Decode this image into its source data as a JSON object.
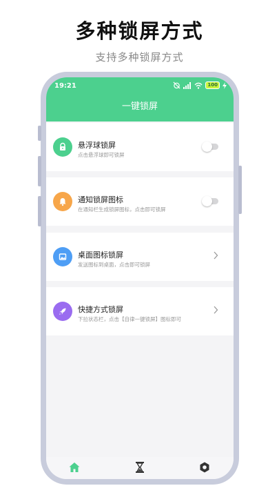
{
  "promo": {
    "title": "多种锁屏方式",
    "subtitle": "支持多种锁屏方式"
  },
  "status_bar": {
    "time": "19:21",
    "battery": "100",
    "icons": [
      "alarm-off-icon",
      "signal-icon",
      "wifi-icon",
      "battery-icon",
      "charging-icon"
    ]
  },
  "header": {
    "title": "一键锁屏"
  },
  "items": [
    {
      "title": "悬浮球锁屏",
      "desc": "点击悬浮球即可锁屏",
      "icon": "lock-icon",
      "icon_color": "#4cd08e",
      "control": "toggle",
      "enabled": false
    },
    {
      "title": "通知锁屏图标",
      "desc": "在通知栏生成锁屏图标，点击即可锁屏",
      "icon": "bell-icon",
      "icon_color": "#f7a64a",
      "control": "toggle",
      "enabled": false
    },
    {
      "title": "桌面图标锁屏",
      "desc": "发送图标到桌面，点击即可锁屏",
      "icon": "image-icon",
      "icon_color": "#4e9ef5",
      "control": "chevron"
    },
    {
      "title": "快捷方式锁屏",
      "desc": "下拉状态栏，点击【自律一键锁屏】图标即可",
      "icon": "rocket-icon",
      "icon_color": "#9a6cf0",
      "control": "chevron"
    }
  ],
  "tabs": [
    {
      "icon": "home-icon",
      "active": true
    },
    {
      "icon": "hourglass-icon",
      "active": false
    },
    {
      "icon": "settings-icon",
      "active": false
    }
  ],
  "colors": {
    "accent": "#4cd08e",
    "frame": "#c8ccdc"
  }
}
